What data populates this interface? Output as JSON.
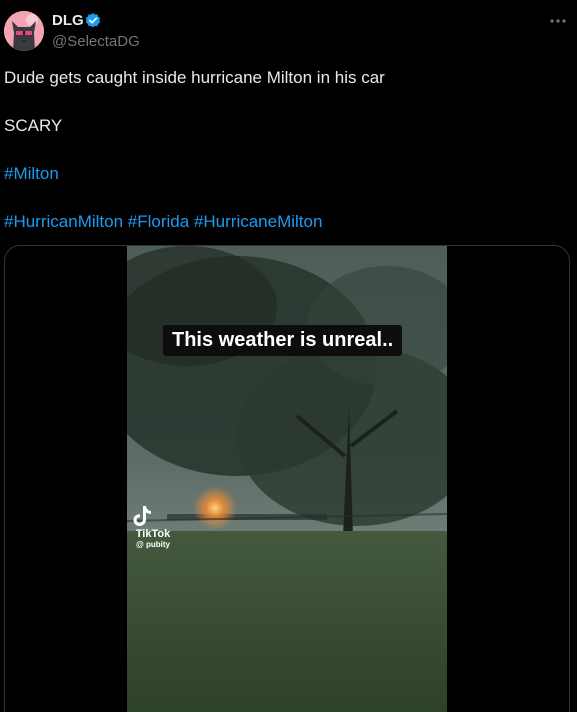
{
  "author": {
    "display_name": "DLG",
    "handle": "@SelectaDG",
    "avatar_icon": "cat-avatar",
    "verified_icon": "verified-badge-icon"
  },
  "tweet": {
    "line1": "Dude gets caught inside hurricane Milton in his car",
    "line2": "SCARY",
    "hashtags_line1": [
      "#Milton"
    ],
    "hashtags_line2": [
      "#HurricanMilton",
      "#Florida",
      "#HurricaneMilton"
    ]
  },
  "media": {
    "caption": "This weather is unreal..",
    "watermark_logo": "TikTok",
    "watermark_user": "@ pubity"
  },
  "colors": {
    "background": "#000000",
    "text": "#e7e9ea",
    "secondary": "#71767b",
    "link": "#1d9bf0",
    "border": "#2f3336"
  }
}
